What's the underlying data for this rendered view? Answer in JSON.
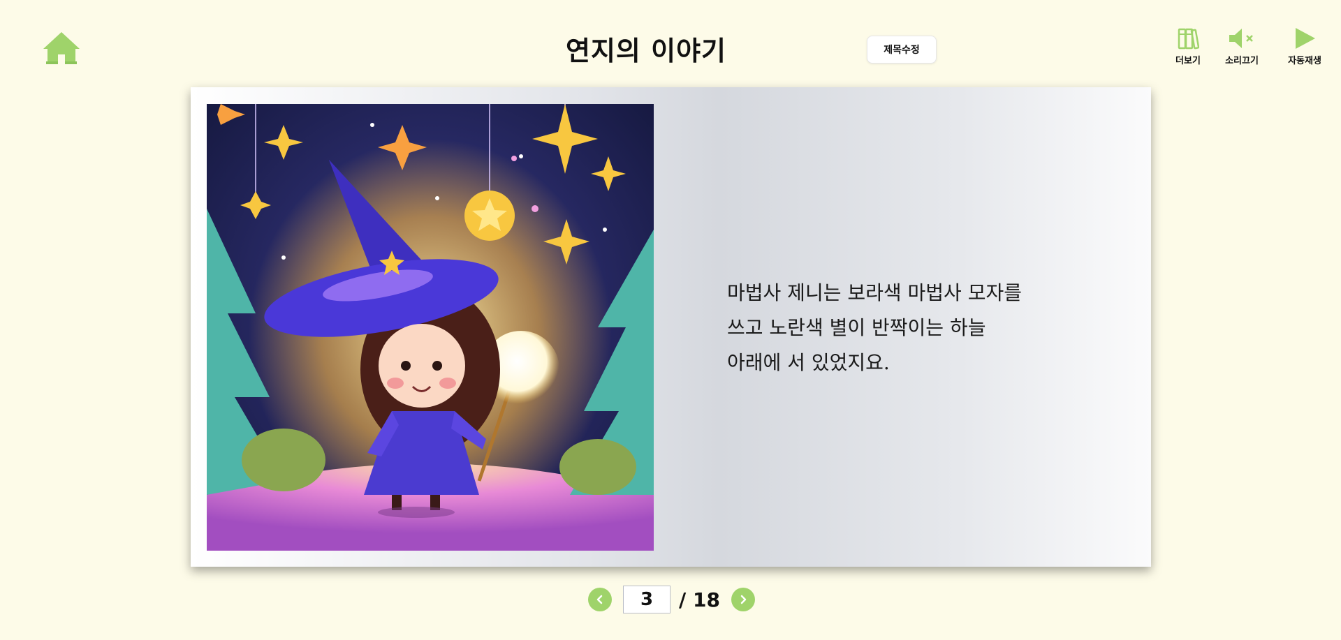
{
  "header": {
    "title": "연지의 이야기",
    "edit_title_label": "제목수정"
  },
  "toolbar": {
    "more_label": "더보기",
    "sound_off_label": "소리끄기",
    "autoplay_label": "자동재생"
  },
  "icons": {
    "home": "home-icon",
    "more": "books-icon",
    "sound_off": "speaker-mute-icon",
    "autoplay": "play-icon",
    "prev": "chevron-left-icon",
    "next": "chevron-right-icon"
  },
  "story": {
    "lines": [
      "마법사 제니는 보라색 마법사 모자를",
      "쓰고 노란색 별이 반짝이는 하늘",
      "아래에 서 있었지요."
    ]
  },
  "pager": {
    "current_page": "3",
    "total_label": "/ 18"
  },
  "colors": {
    "accent_green": "#9fd36a",
    "background": "#fdfbe8"
  }
}
